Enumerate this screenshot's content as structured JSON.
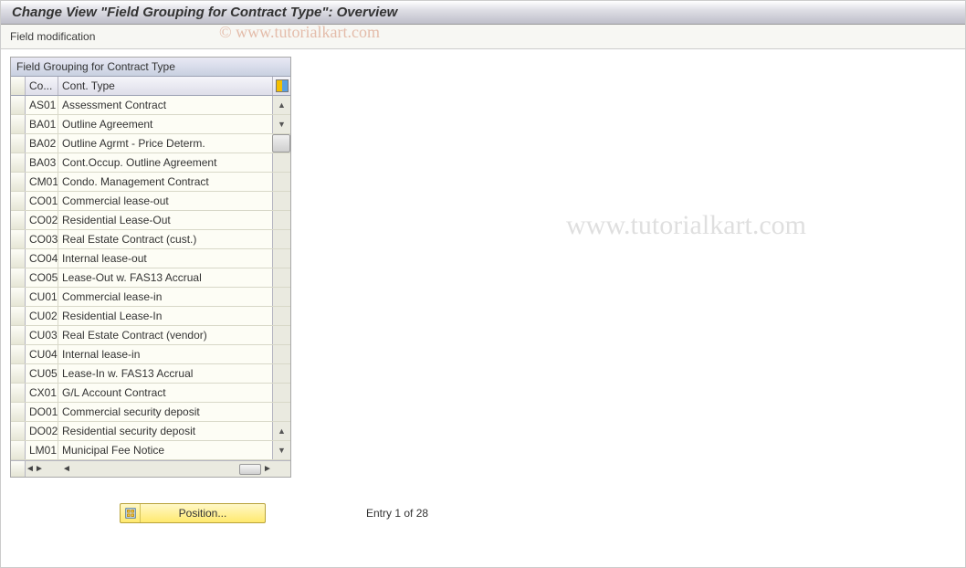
{
  "window": {
    "title": "Change View \"Field Grouping for Contract Type\": Overview"
  },
  "toolbar": {
    "field_modification": "Field modification"
  },
  "table": {
    "title": "Field Grouping for Contract Type",
    "headers": {
      "code": "Co...",
      "type": "Cont. Type"
    },
    "rows": [
      {
        "code": "AS01",
        "type": "Assessment Contract"
      },
      {
        "code": "BA01",
        "type": "Outline Agreement"
      },
      {
        "code": "BA02",
        "type": "Outline Agrmt - Price Determ."
      },
      {
        "code": "BA03",
        "type": "Cont.Occup. Outline Agreement"
      },
      {
        "code": "CM01",
        "type": "Condo. Management Contract"
      },
      {
        "code": "CO01",
        "type": "Commercial lease-out"
      },
      {
        "code": "CO02",
        "type": "Residential Lease-Out"
      },
      {
        "code": "CO03",
        "type": "Real Estate Contract (cust.)"
      },
      {
        "code": "CO04",
        "type": "Internal lease-out"
      },
      {
        "code": "CO05",
        "type": "Lease-Out w. FAS13 Accrual"
      },
      {
        "code": "CU01",
        "type": "Commercial lease-in"
      },
      {
        "code": "CU02",
        "type": "Residential Lease-In"
      },
      {
        "code": "CU03",
        "type": "Real Estate Contract (vendor)"
      },
      {
        "code": "CU04",
        "type": "Internal lease-in"
      },
      {
        "code": "CU05",
        "type": "Lease-In w. FAS13 Accrual"
      },
      {
        "code": "CX01",
        "type": "G/L Account Contract"
      },
      {
        "code": "DO01",
        "type": "Commercial security deposit"
      },
      {
        "code": "DO02",
        "type": "Residential security deposit"
      },
      {
        "code": "LM01",
        "type": "Municipal Fee Notice"
      }
    ]
  },
  "footer": {
    "position_button": "Position...",
    "entry_status": "Entry 1 of 28"
  },
  "watermark": {
    "top": "© www.tutorialkart.com",
    "mid": "www.tutorialkart.com"
  }
}
